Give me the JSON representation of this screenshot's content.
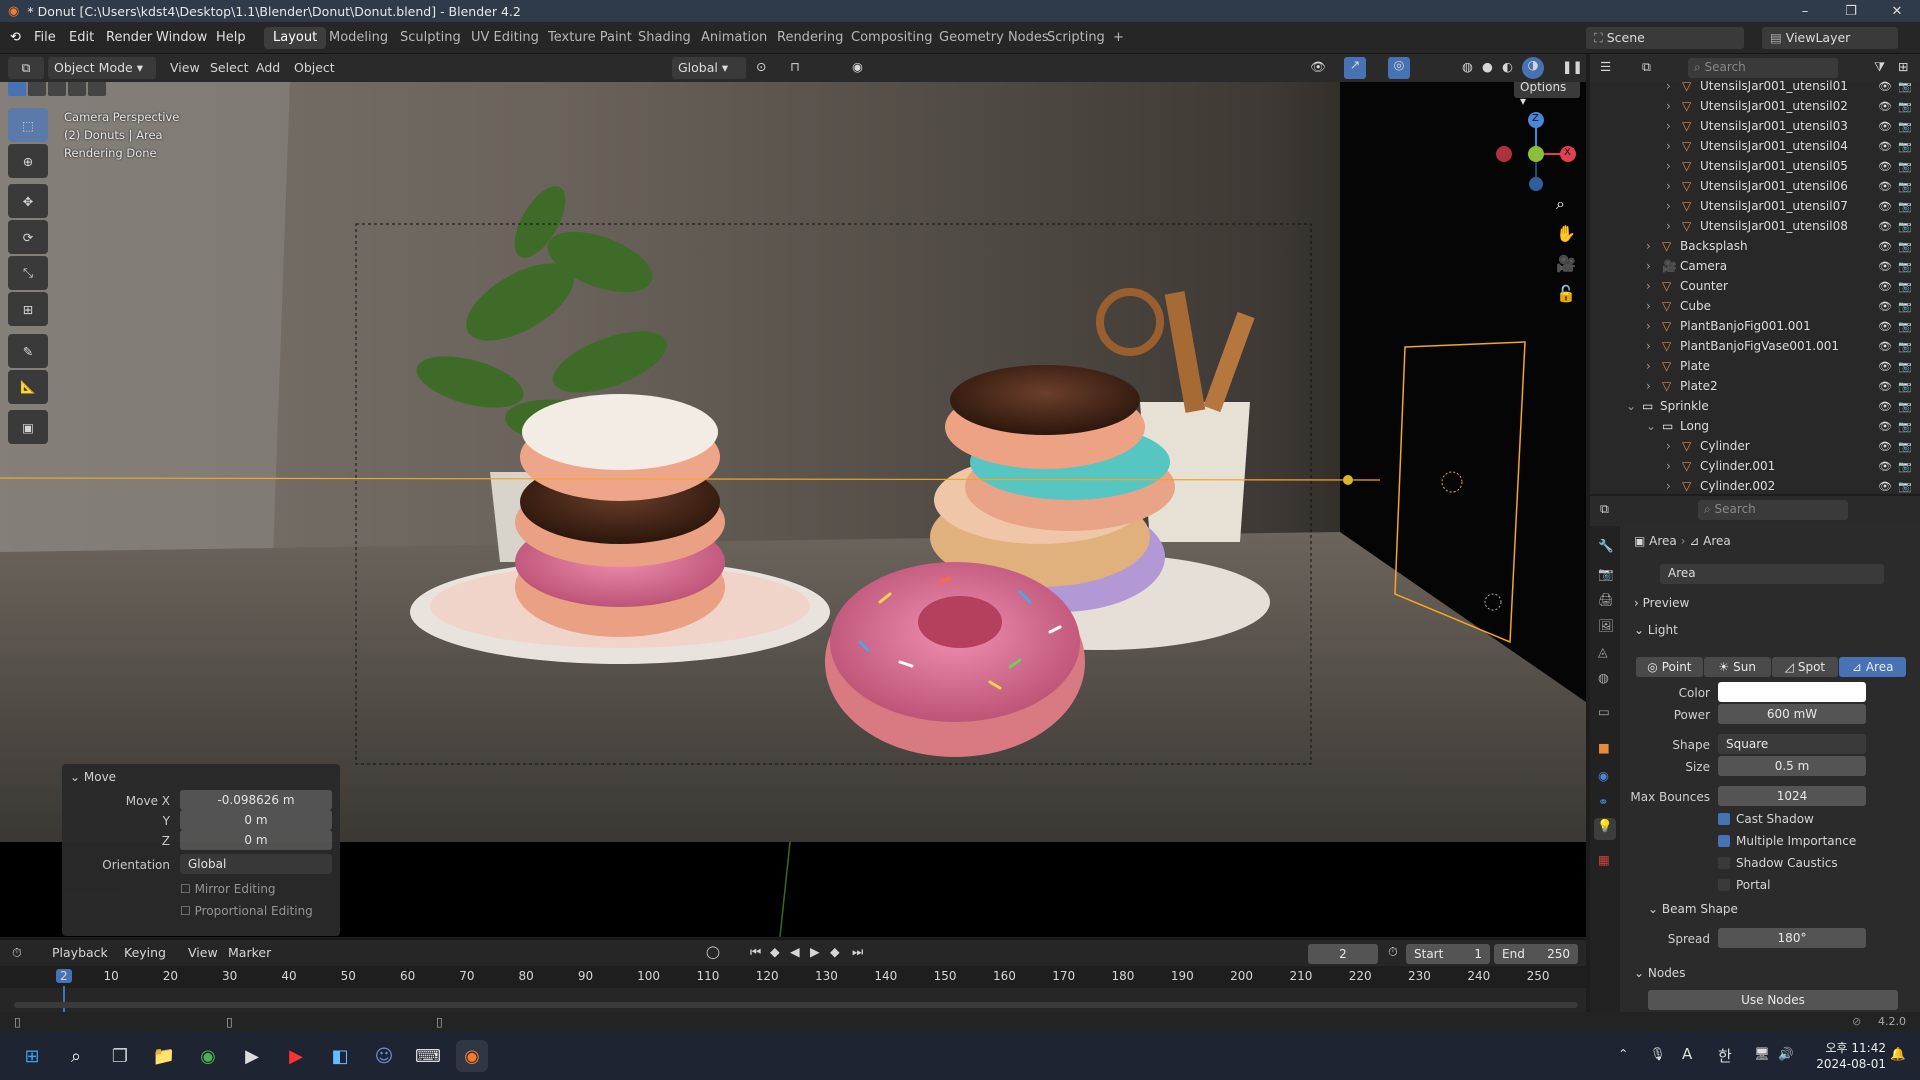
{
  "window": {
    "title": "* Donut [C:\\Users\\kdst4\\Desktop\\1.1\\Blender\\Donut\\Donut.blend] - Blender 4.2",
    "controls": [
      "–",
      "❐",
      "✕"
    ]
  },
  "menu": {
    "items": [
      "File",
      "Edit",
      "Render",
      "Window",
      "Help"
    ],
    "workspaces": [
      "Layout",
      "Modeling",
      "Sculpting",
      "UV Editing",
      "Texture Paint",
      "Shading",
      "Animation",
      "Rendering",
      "Compositing",
      "Geometry Nodes",
      "Scripting",
      "+"
    ],
    "active_workspace": "Layout",
    "scene": "Scene",
    "view_layer": "ViewLayer"
  },
  "viewport_header": {
    "mode": "Object Mode",
    "menus": [
      "View",
      "Select",
      "Add",
      "Object"
    ],
    "orientation": "Global",
    "options_label": "Options"
  },
  "viewport": {
    "info": [
      "Camera Perspective",
      "(2) Donuts | Area",
      "Rendering Done"
    ],
    "gizmo": {
      "z": "Z",
      "x": "X"
    }
  },
  "operator_panel": {
    "title": "Move",
    "move_x_label": "Move X",
    "move_x": "-0.098626 m",
    "y_label": "Y",
    "y": "0 m",
    "z_label": "Z",
    "z": "0 m",
    "orientation_label": "Orientation",
    "orientation": "Global",
    "mirror": "Mirror Editing",
    "proportional": "Proportional Editing"
  },
  "outliner": {
    "search_placeholder": "Search",
    "rows": [
      {
        "name": "UtensilsJar001_utensil01",
        "indent": 3,
        "type": "mesh"
      },
      {
        "name": "UtensilsJar001_utensil02",
        "indent": 3,
        "type": "mesh"
      },
      {
        "name": "UtensilsJar001_utensil03",
        "indent": 3,
        "type": "mesh"
      },
      {
        "name": "UtensilsJar001_utensil04",
        "indent": 3,
        "type": "mesh"
      },
      {
        "name": "UtensilsJar001_utensil05",
        "indent": 3,
        "type": "mesh"
      },
      {
        "name": "UtensilsJar001_utensil06",
        "indent": 3,
        "type": "mesh"
      },
      {
        "name": "UtensilsJar001_utensil07",
        "indent": 3,
        "type": "mesh"
      },
      {
        "name": "UtensilsJar001_utensil08",
        "indent": 3,
        "type": "mesh"
      },
      {
        "name": "Backsplash",
        "indent": 2,
        "type": "mesh"
      },
      {
        "name": "Camera",
        "indent": 2,
        "type": "camera"
      },
      {
        "name": "Counter",
        "indent": 2,
        "type": "mesh"
      },
      {
        "name": "Cube",
        "indent": 2,
        "type": "mesh"
      },
      {
        "name": "PlantBanjoFig001.001",
        "indent": 2,
        "type": "mesh"
      },
      {
        "name": "PlantBanjoFigVase001.001",
        "indent": 2,
        "type": "mesh"
      },
      {
        "name": "Plate",
        "indent": 2,
        "type": "mesh"
      },
      {
        "name": "Plate2",
        "indent": 2,
        "type": "mesh"
      },
      {
        "name": "Sprinkle",
        "indent": 1,
        "type": "collection"
      },
      {
        "name": "Long",
        "indent": 2,
        "type": "collection"
      },
      {
        "name": "Cylinder",
        "indent": 3,
        "type": "mesh"
      },
      {
        "name": "Cylinder.001",
        "indent": 3,
        "type": "mesh"
      },
      {
        "name": "Cylinder.002",
        "indent": 3,
        "type": "mesh"
      }
    ]
  },
  "properties": {
    "search_placeholder": "Search",
    "breadcrumb": [
      "Area",
      "Area"
    ],
    "datablock": "Area",
    "sections": {
      "preview": "Preview",
      "light": "Light",
      "beam": "Beam Shape",
      "nodes": "Nodes"
    },
    "light_types": [
      "Point",
      "Sun",
      "Spot",
      "Area"
    ],
    "active_light_type": "Area",
    "color_label": "Color",
    "power_label": "Power",
    "power": "600 mW",
    "shape_label": "Shape",
    "shape": "Square",
    "size_label": "Size",
    "size": "0.5 m",
    "bounces_label": "Max Bounces",
    "bounces": "1024",
    "checks": [
      {
        "label": "Cast Shadow",
        "checked": true
      },
      {
        "label": "Multiple Importance",
        "checked": true
      },
      {
        "label": "Shadow Caustics",
        "checked": false
      },
      {
        "label": "Portal",
        "checked": false
      }
    ],
    "spread_label": "Spread",
    "spread": "180°",
    "use_nodes": "Use Nodes"
  },
  "timeline": {
    "menus": [
      "Playback",
      "Keying",
      "View",
      "Marker"
    ],
    "current_frame": "2",
    "start_label": "Start",
    "start": "1",
    "end_label": "End",
    "end": "250",
    "ruler": [
      "2",
      "10",
      "20",
      "30",
      "40",
      "50",
      "60",
      "70",
      "80",
      "90",
      "100",
      "110",
      "120",
      "130",
      "140",
      "150",
      "160",
      "170",
      "180",
      "190",
      "200",
      "210",
      "220",
      "230",
      "240",
      "250"
    ]
  },
  "status": {
    "version": "4.2.0"
  },
  "taskbar": {
    "time": "11:42",
    "date": "2024-08-01",
    "ampm": "오후",
    "ime": "A",
    "ime2": "한"
  },
  "colors": {
    "accent": "#4772b3",
    "selected_orange": "#f5a623",
    "active_tab": "#3d3d3d"
  }
}
